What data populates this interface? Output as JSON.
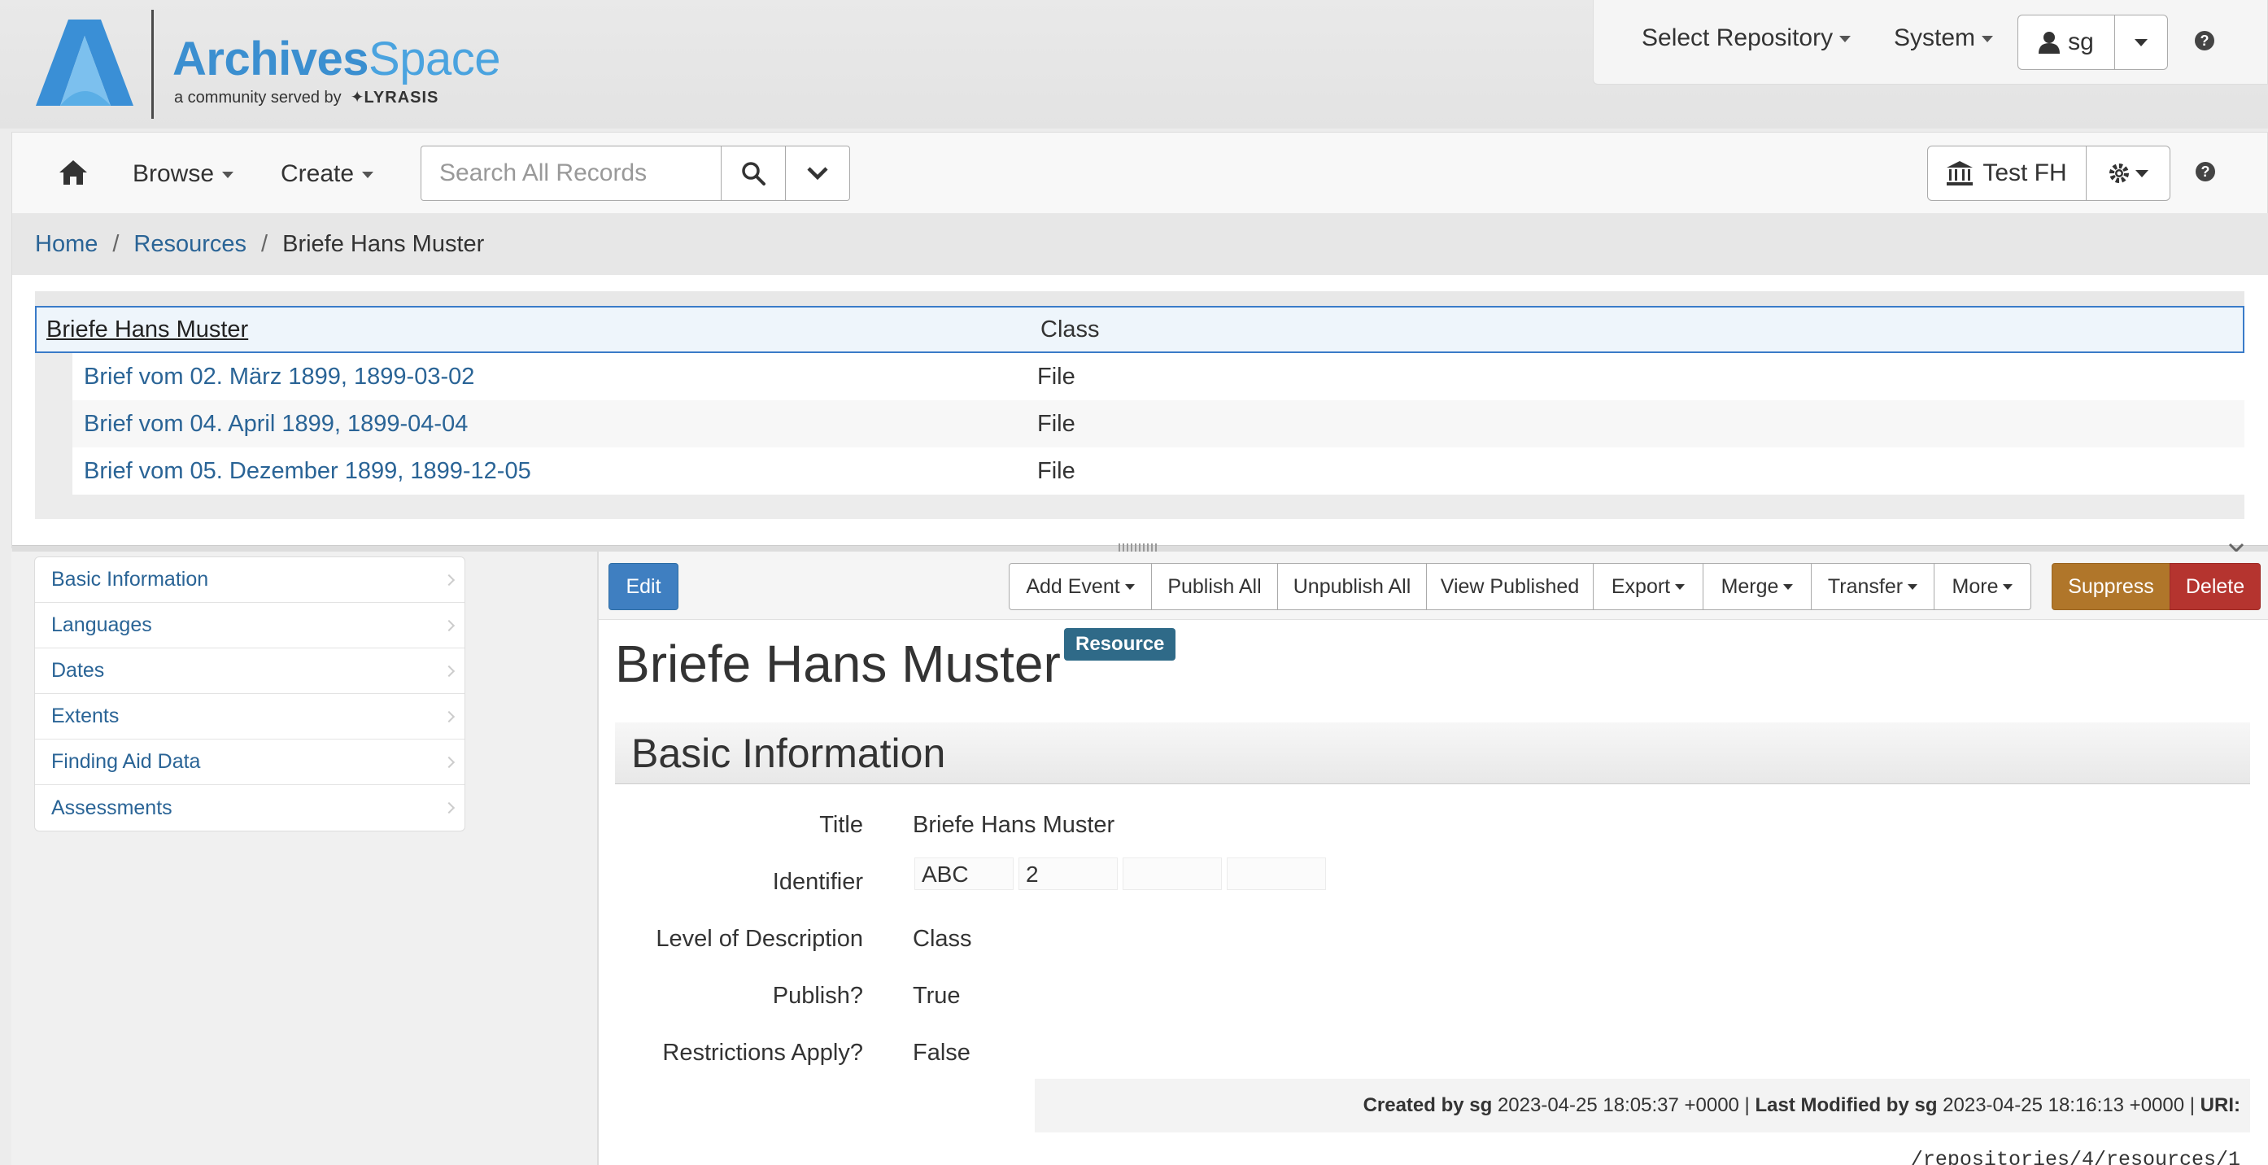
{
  "brand": {
    "name_bold": "Archives",
    "name_light": "Space",
    "tagline": "a community served by",
    "partner": "LYRASIS"
  },
  "user_panel": {
    "select_repository": "Select Repository",
    "system": "System",
    "user": "sg"
  },
  "navbar": {
    "browse": "Browse",
    "create": "Create",
    "search_placeholder": "Search All Records",
    "repository": "Test FH"
  },
  "breadcrumb": [
    "Home",
    "Resources",
    "Briefe Hans Muster"
  ],
  "tree": {
    "root": {
      "title": "Briefe Hans Muster",
      "level": "Class"
    },
    "children": [
      {
        "title": "Brief vom 02. März 1899, 1899-03-02",
        "level": "File"
      },
      {
        "title": "Brief vom 04. April 1899, 1899-04-04",
        "level": "File"
      },
      {
        "title": "Brief vom 05. Dezember 1899, 1899-12-05",
        "level": "File"
      }
    ]
  },
  "sidebar": {
    "items": [
      "Basic Information",
      "Languages",
      "Dates",
      "Extents",
      "Finding Aid Data",
      "Assessments"
    ]
  },
  "toolbar": {
    "edit": "Edit",
    "add_event": "Add Event",
    "publish_all": "Publish All",
    "unpublish_all": "Unpublish All",
    "view_published": "View Published",
    "export": "Export",
    "merge": "Merge",
    "transfer": "Transfer",
    "more": "More",
    "suppress": "Suppress",
    "delete": "Delete"
  },
  "record": {
    "title": "Briefe Hans Muster",
    "badge": "Resource",
    "section": "Basic Information",
    "fields": {
      "title_label": "Title",
      "title_value": "Briefe Hans Muster",
      "identifier_label": "Identifier",
      "identifier_parts": [
        "ABC",
        "2",
        "",
        ""
      ],
      "level_label": "Level of Description",
      "level_value": "Class",
      "publish_label": "Publish?",
      "publish_value": "True",
      "restrictions_label": "Restrictions Apply?",
      "restrictions_value": "False"
    },
    "audit": {
      "created_label": "Created by sg",
      "created_at": "2023-04-25 18:05:37 +0000",
      "modified_label": "Last Modified by sg",
      "modified_at": "2023-04-25 18:16:13 +0000",
      "uri_label": "URI:",
      "uri": "/repositories/4/resources/1"
    }
  },
  "colors": {
    "accent_link": "#2a6496",
    "edit_button": "#3f7fc1",
    "suppress_button": "#b0762a",
    "delete_button": "#b5342f",
    "badge": "#2f6a88",
    "logo_blue": "#4aa3df"
  }
}
